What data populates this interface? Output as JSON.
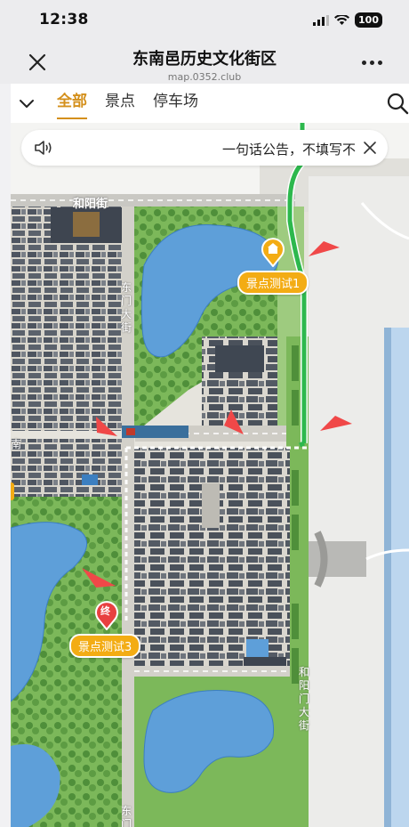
{
  "status": {
    "time": "12:38",
    "battery": "100"
  },
  "header": {
    "title": "东南邑历史文化街区",
    "url": "map.0352.club"
  },
  "tabs": [
    {
      "label": "全部",
      "active": true
    },
    {
      "label": "景点",
      "active": false
    },
    {
      "label": "停车场",
      "active": false
    }
  ],
  "notice": {
    "text": "一句话公告，不填写不"
  },
  "map": {
    "street_labels": {
      "heyang_street": "和阳街",
      "dongmen_street": "东门大街",
      "heyang_alley": "和阳门大街",
      "bottom_street": "东门",
      "left_cut": "南"
    },
    "pois": [
      {
        "label": "景点测试1",
        "marker_glyph": "🏛"
      },
      {
        "label": "景点测试3",
        "marker_glyph": "终"
      }
    ]
  },
  "colors": {
    "accent": "#d4901c",
    "poi": "#f3ac14",
    "route": "#2db84d",
    "arrow": "#f04848",
    "water": "#5e9fd9",
    "green": "#6fb04e"
  },
  "icons": [
    "close-icon",
    "more-icon",
    "chevron-down-icon",
    "search-icon",
    "speaker-icon",
    "close-icon",
    "wifi-icon",
    "signal-icon",
    "battery-icon"
  ]
}
